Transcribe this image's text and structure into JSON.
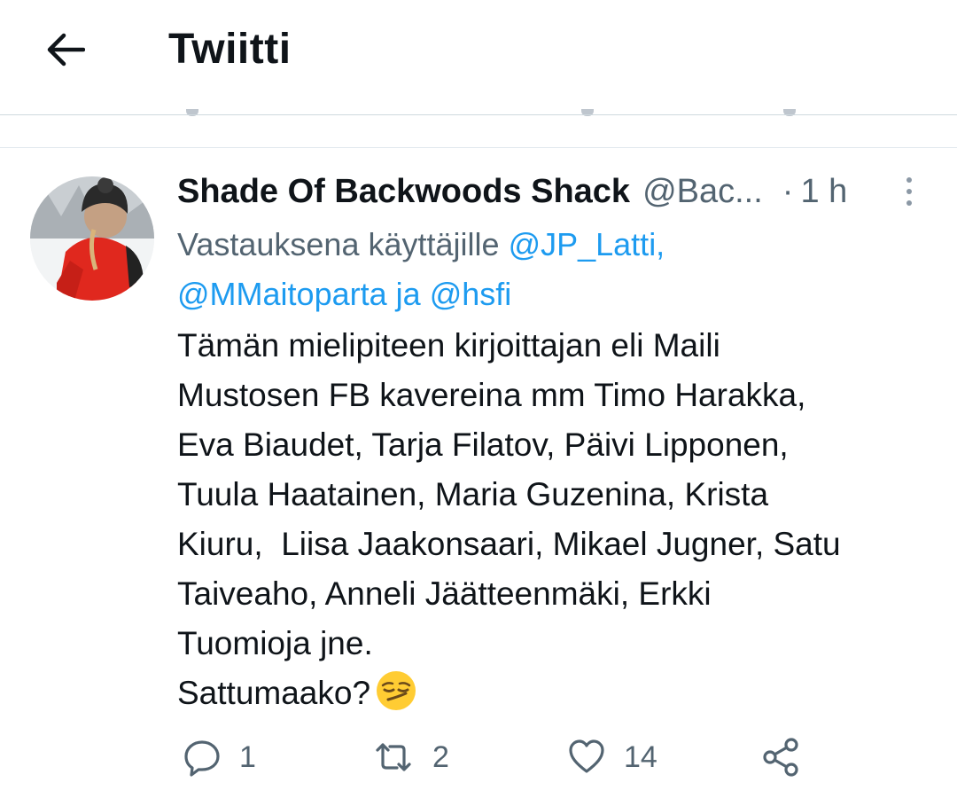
{
  "header": {
    "title": "Twiitti",
    "back_icon": "arrow-left-icon"
  },
  "tweet": {
    "author_name": "Shade Of Backwoods Shack",
    "handle": "@Bac...",
    "separator": "·",
    "time": "1 h",
    "reply_prefix": "Vastauksena käyttäjille",
    "mention_1": "@JP_Latti,",
    "mention_2": "@MMaitoparta",
    "reply_joiner": "ja",
    "mention_3": "@hsfi",
    "text_lines": [
      "Tämän mielipiteen kirjoittajan eli Maili",
      "Mustosen FB kavereina mm Timo Harakka,",
      "Eva Biaudet, Tarja Filatov, Päivi Lipponen,",
      "Tuula Haatainen, Maria Guzenina, Krista",
      "Kiuru,  Liisa Jaakonsaari, Mikael Jugner, Satu",
      "Taiveaho, Anneli Jäätteenmäki, Erkki",
      "Tuomioja jne.",
      "Sattumaako?"
    ],
    "emoji": "smirking-face-emoji"
  },
  "actions": {
    "reply_count": "1",
    "retweet_count": "2",
    "like_count": "14"
  },
  "colors": {
    "link": "#1d9bf0",
    "secondary_text": "#536471",
    "divider": "#cfd9de",
    "avatar_jacket": "#e0281e"
  }
}
